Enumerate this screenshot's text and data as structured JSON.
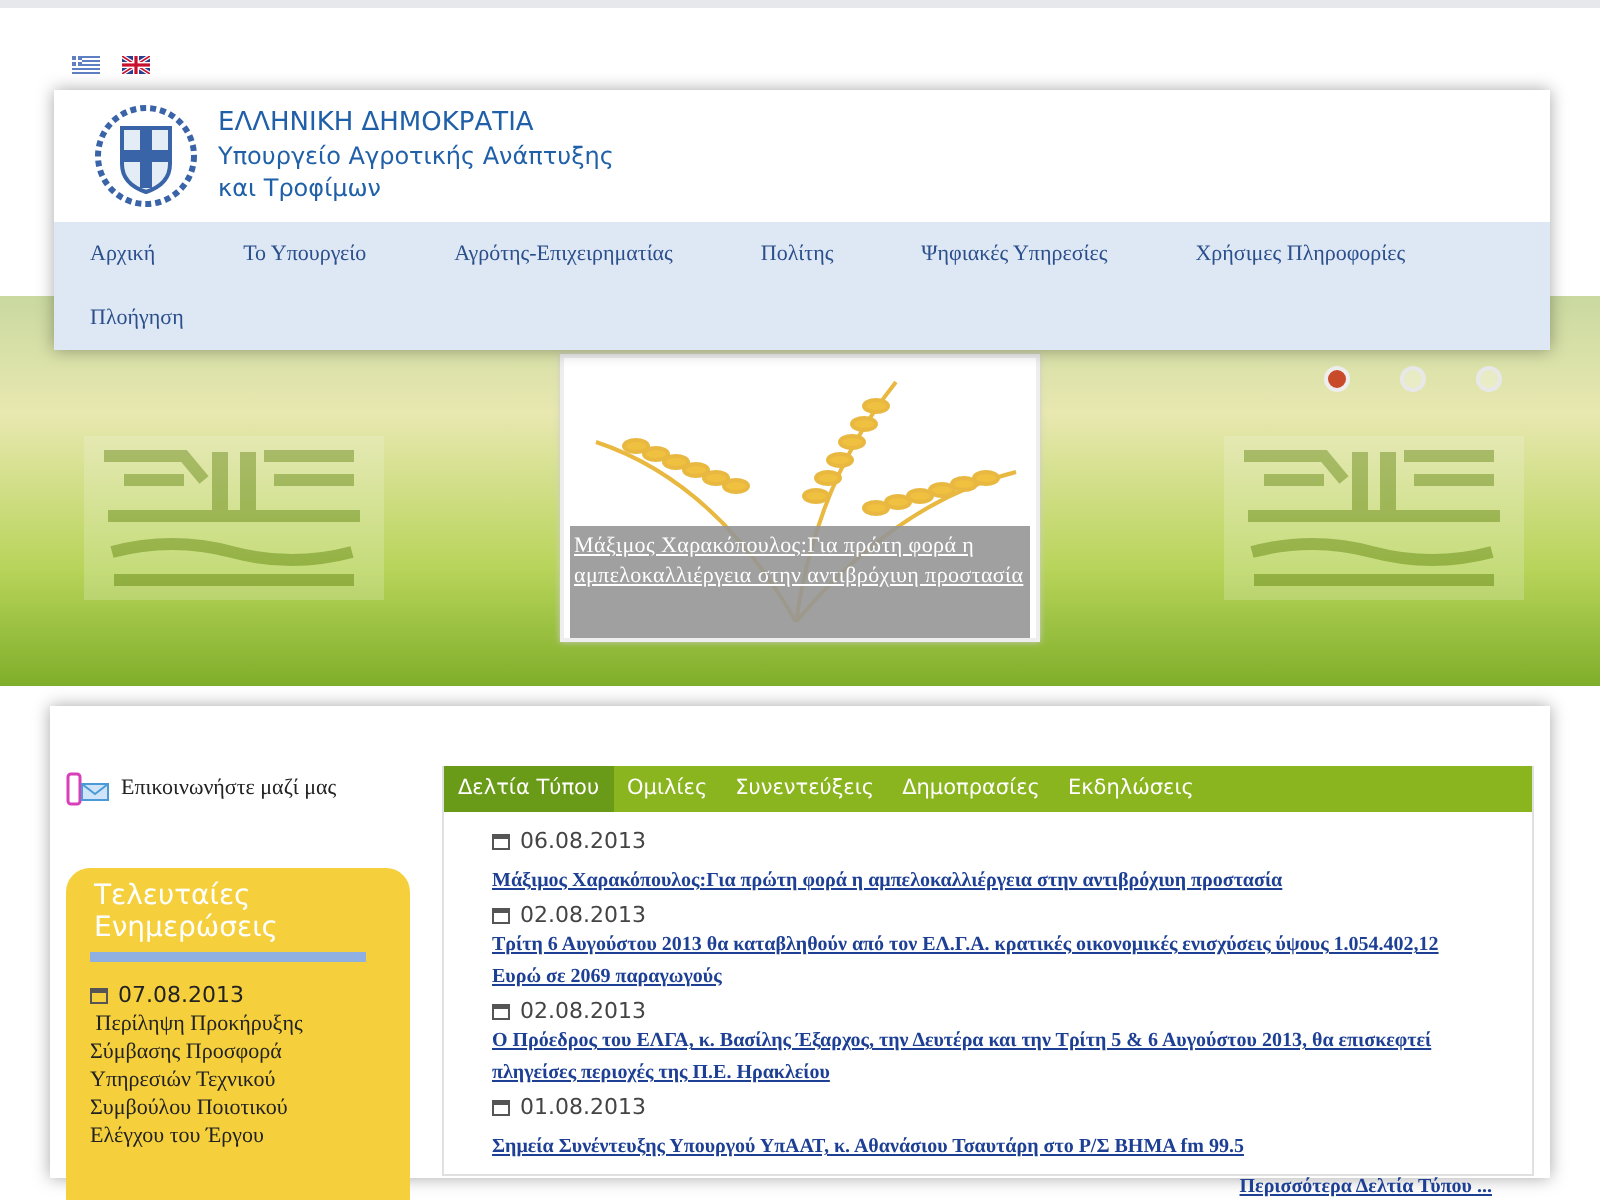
{
  "language_flags": [
    {
      "kind": "greek"
    },
    {
      "kind": "english"
    }
  ],
  "header": {
    "title": "ΕΛΛΗΝΙΚΗ ΔΗΜΟΚΡΑΤΙΑ",
    "subtitle_lines": [
      "Υπουργείο Αγροτικής Ανάπτυξης",
      "και Τροφίμων"
    ]
  },
  "nav": {
    "items": [
      "Αρχική",
      "Το Υπουργείο",
      "Αγρότης-Επιχειρηματίας",
      "Πολίτης",
      "Ψηφιακές Υπηρεσίες",
      "Χρήσιμες Πληροφορίες",
      "Πλοήγηση"
    ]
  },
  "slider": {
    "caption": "Μάξιμος Χαρακόπουλος:Για πρώτη φορά η αμπελοκαλλιέργεια στην αντιβρόχιυη προστασία",
    "dots": [
      {
        "selected": true
      },
      {
        "selected": false
      },
      {
        "selected": false
      }
    ]
  },
  "contact": {
    "label": "Επικοινωνήστε μαζί μας"
  },
  "updates": {
    "title": "Τελευταίες Ενημερώσεις",
    "items": [
      {
        "date": "07.08.2013",
        "text": "Περίληψη Προκήρυξης Σύμβασης Προσφορά Υπηρεσιών Τεχνικού Συμβούλου Ποιοτικού Ελέγχου του Έργου"
      }
    ]
  },
  "news": {
    "tabs": [
      {
        "label": "Δελτία Τύπου",
        "selected": true
      },
      {
        "label": "Ομιλίες",
        "selected": false
      },
      {
        "label": "Συνεντεύξεις",
        "selected": false
      },
      {
        "label": "Δημοπρασίες",
        "selected": false
      },
      {
        "label": "Εκδηλώσεις",
        "selected": false
      }
    ],
    "items": [
      {
        "date": "06.08.2013",
        "title": "Μάξιμος Χαρακόπουλος:Για πρώτη φορά η αμπελοκαλλιέργεια στην αντιβρόχιυη προστασία"
      },
      {
        "date": "02.08.2013",
        "title": "Τρίτη 6 Αυγούστου 2013 θα καταβληθούν από τον ΕΛ.Γ.Α. κρατικές οικονομικές ενισχύσεις ύψους 1.054.402,12 Ευρώ σε 2069 παραγωγούς"
      },
      {
        "date": "02.08.2013",
        "title": "Ο Πρόεδρος του ΕΛΓΑ, κ. Βασίλης Έξαρχος, την Δευτέρα και την Τρίτη 5 & 6 Αυγούστου 2013, θα επισκεφτεί πληγείσες περιοχές της Π.Ε. Ηρακλείου"
      },
      {
        "date": "01.08.2013",
        "title": "Σημεία Συνέντευξης Υπουργού ΥπΑΑΤ, κ. Αθανάσιου Τσαυτάρη στο Ρ/Σ ΒΗΜΑ fm 99.5"
      }
    ],
    "more": "Περισσότερα Δελτία Τύπου ..."
  }
}
